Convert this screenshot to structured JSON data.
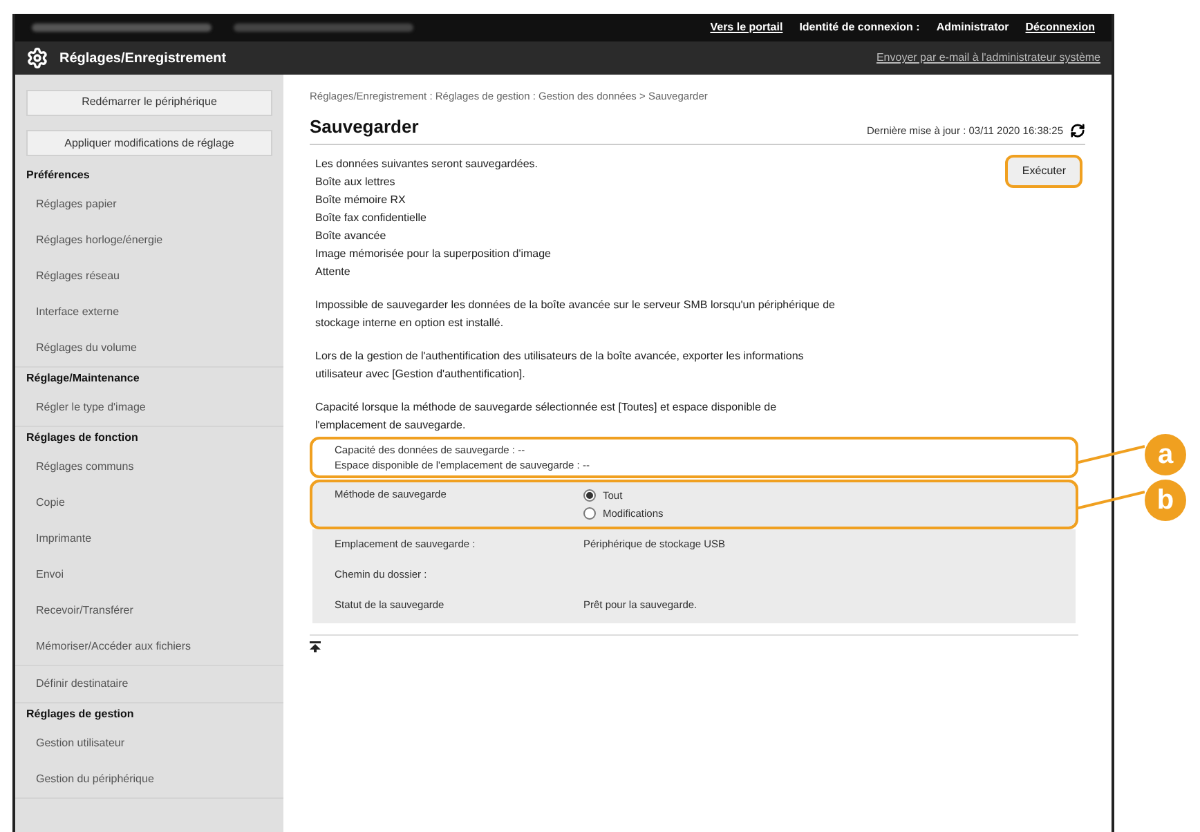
{
  "top_bar": {
    "links": [
      {
        "label": "Vers le portail",
        "kind": "link"
      },
      {
        "label": "Identité de connexion :",
        "kind": "text"
      },
      {
        "label": "Administrator",
        "kind": "text"
      },
      {
        "label": "Déconnexion",
        "kind": "link"
      }
    ]
  },
  "header": {
    "title": "Réglages/Enregistrement",
    "email_link": "Envoyer par e-mail à l'administrateur système"
  },
  "sidebar": {
    "buttons": [
      "Redémarrer le périphérique",
      "Appliquer modifications de réglage"
    ],
    "groups": [
      {
        "heading": "Préférences",
        "items": [
          "Réglages papier",
          "Réglages horloge/énergie",
          "Réglages réseau",
          "Interface externe",
          "Réglages du volume"
        ]
      },
      {
        "heading": "Réglage/Maintenance",
        "items": [
          "Régler le type d'image"
        ]
      },
      {
        "heading": "Réglages de fonction",
        "items": [
          "Réglages communs",
          "Copie",
          "Imprimante",
          "Envoi",
          "Recevoir/Transférer",
          "Mémoriser/Accéder aux fichiers"
        ]
      },
      {
        "items": [
          "Définir destinataire"
        ]
      },
      {
        "heading": "Réglages de gestion",
        "items": [
          "Gestion utilisateur",
          "Gestion du périphérique"
        ]
      }
    ]
  },
  "breadcrumb": "Réglages/Enregistrement : Réglages de gestion : Gestion des données > Sauvegarder",
  "page_title": "Sauvegarder",
  "last_update": "Dernière mise à jour : 03/11 2020 16:38:25",
  "execute_button": "Exécuter",
  "intro_lines": [
    "Les données suivantes seront sauvegardées.",
    "Boîte aux lettres",
    "Boîte mémoire RX",
    "Boîte fax confidentielle",
    "Boîte avancée",
    "Image mémorisée pour la superposition d'image",
    "Attente"
  ],
  "notes": [
    "Impossible de sauvegarder les données de la boîte avancée sur le serveur SMB lorsqu'un périphérique de stockage interne en option est installé.",
    "Lors de la gestion de l'authentification des utilisateurs de la boîte avancée, exporter les informations utilisateur avec [Gestion d'authentification].",
    "Capacité lorsque la méthode de sauvegarde sélectionnée est [Toutes] et espace disponible de l'emplacement de sauvegarde."
  ],
  "capacity": {
    "lines": [
      "Capacité des données de sauvegarde : --",
      "Espace disponible de l'emplacement de sauvegarde : --"
    ],
    "callout": "a"
  },
  "method": {
    "label": "Méthode de sauvegarde",
    "options": [
      {
        "label": "Tout",
        "selected": true
      },
      {
        "label": "Modifications",
        "selected": false
      }
    ],
    "callout": "b"
  },
  "details": [
    {
      "label": "Emplacement de sauvegarde :",
      "value": "Périphérique de stockage USB"
    },
    {
      "label": "Chemin du dossier :"
    },
    {
      "label": "Statut de la sauvegarde",
      "value": "Prêt pour la sauvegarde."
    }
  ]
}
